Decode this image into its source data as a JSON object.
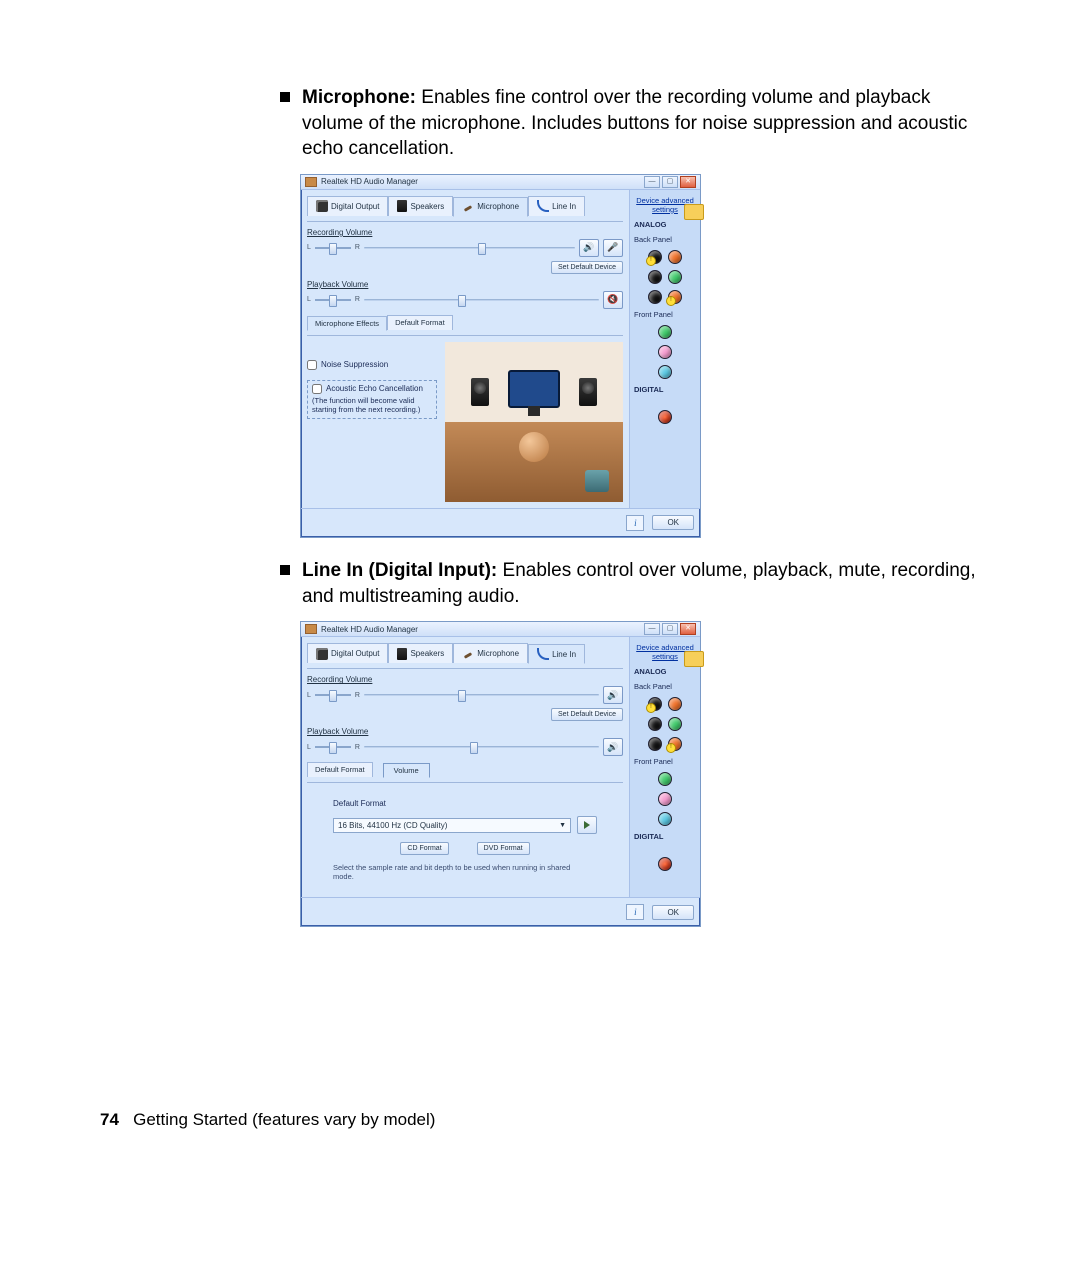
{
  "doc": {
    "item1_bold": "Microphone:",
    "item1_text": " Enables fine control over the recording volume and playback volume of the microphone. Includes buttons for noise suppression and acoustic echo cancellation.",
    "item2_bold": "Line In (Digital Input):",
    "item2_text": " Enables control over volume, playback, mute, recording, and multistreaming audio.",
    "page_num": "74",
    "footer_text": "Getting Started (features vary by model)"
  },
  "win": {
    "title": "Realtek HD Audio Manager",
    "tabs": {
      "digital": "Digital Output",
      "speakers": "Speakers",
      "mic": "Microphone",
      "linein": "Line In"
    },
    "side": {
      "adv_link": "Device advanced settings",
      "analog": "ANALOG",
      "back_panel": "Back Panel",
      "front_panel": "Front Panel",
      "digital": "DIGITAL"
    },
    "rec_vol": "Recording Volume",
    "pb_vol": "Playback Volume",
    "L": "L",
    "R": "R",
    "set_default": "Set Default Device",
    "subtabs": {
      "effects": "Microphone Effects",
      "default_fmt": "Default Format",
      "volume": "Volume"
    },
    "noise_suppression": "Noise Suppression",
    "aec_label": "Acoustic Echo Cancellation",
    "aec_note": "(The function will become valid starting from the next recording.)",
    "ok": "OK"
  },
  "win2": {
    "df_title": "Default Format",
    "df_value": "16 Bits, 44100 Hz (CD Quality)",
    "cd_btn": "CD Format",
    "dvd_btn": "DVD Format",
    "df_note": "Select the sample rate and bit depth to be used when running in shared mode."
  }
}
